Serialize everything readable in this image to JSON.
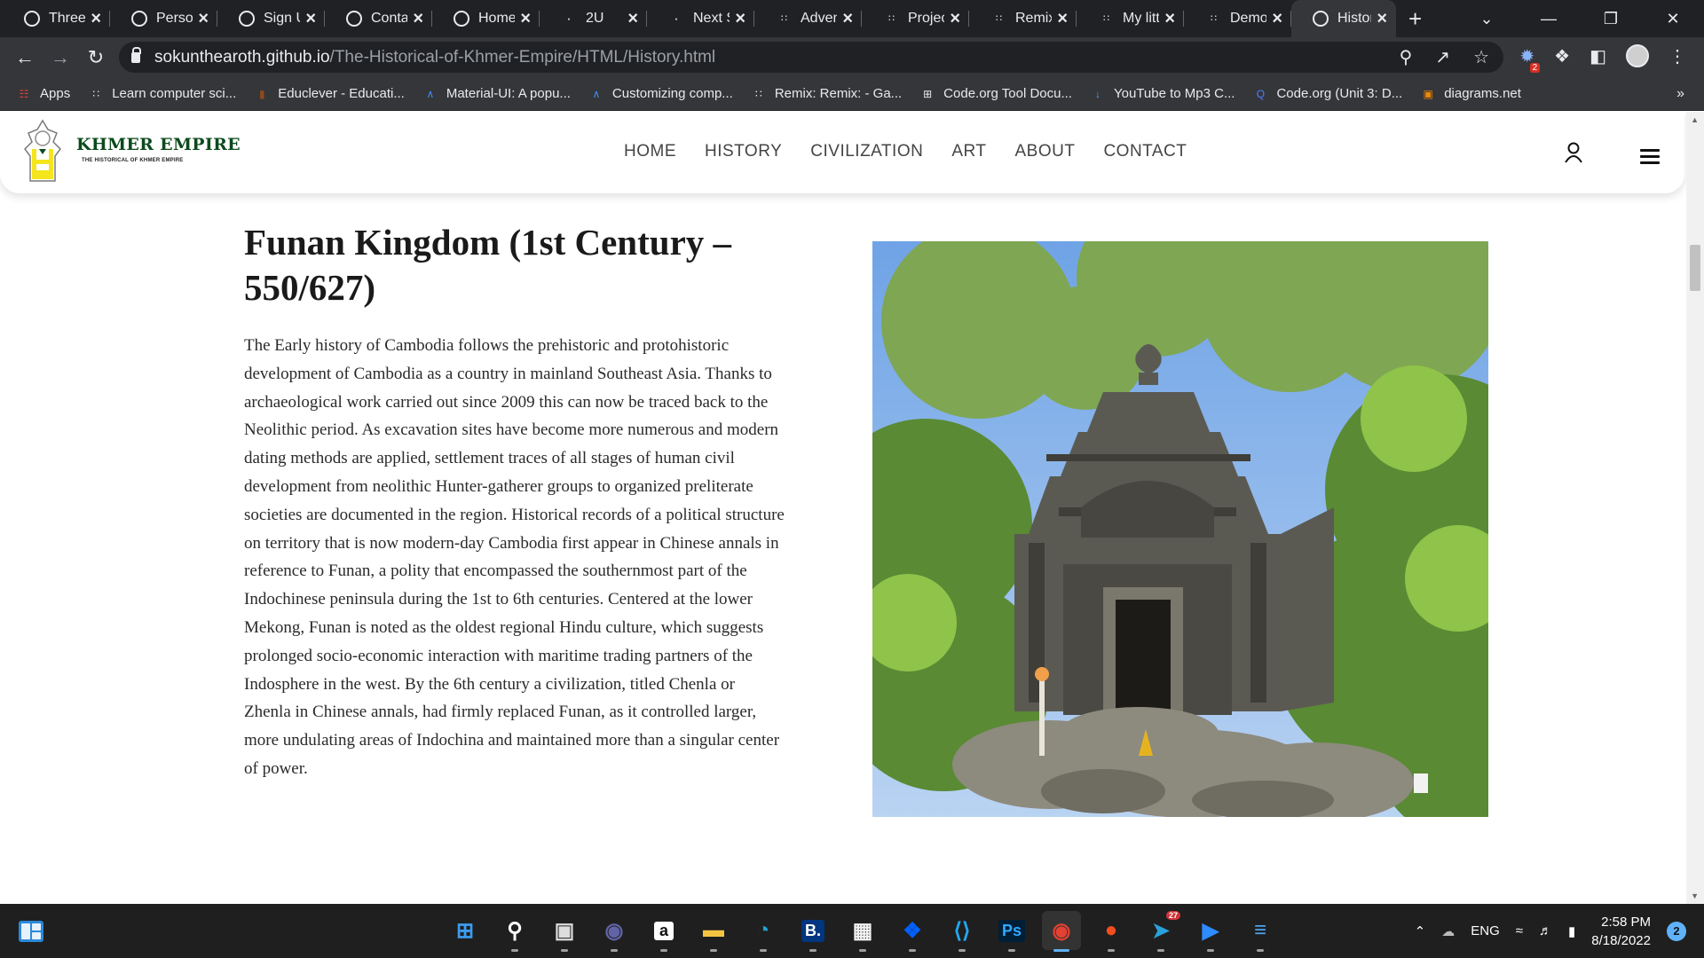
{
  "browser": {
    "tabs": [
      {
        "title": "Three",
        "icon": "globe-icon"
      },
      {
        "title": "Persor",
        "icon": "globe-icon"
      },
      {
        "title": "Sign U",
        "icon": "globe-icon"
      },
      {
        "title": "Conta",
        "icon": "globe-icon"
      },
      {
        "title": "Home",
        "icon": "globe-icon"
      },
      {
        "title": "2U",
        "icon": "page-icon"
      },
      {
        "title": "Next S",
        "icon": "next-icon"
      },
      {
        "title": "Adven",
        "icon": "codeorg-icon"
      },
      {
        "title": "Projec",
        "icon": "codeorg-icon"
      },
      {
        "title": "Remix",
        "icon": "codeorg-icon"
      },
      {
        "title": "My litt",
        "icon": "codeorg-icon"
      },
      {
        "title": "Demo",
        "icon": "codeorg-icon"
      },
      {
        "title": "Histor",
        "icon": "globe-icon",
        "active": true
      }
    ],
    "url_host": "sokunthearoth.github.io",
    "url_path": "/The-Historical-of-Khmer-Empire/HTML/History.html",
    "extension_badge": "2",
    "bookmarks": [
      {
        "label": "Apps",
        "icon": "apps-grid-icon",
        "color": "#ea4335"
      },
      {
        "label": "Learn computer sci...",
        "icon": "codeorg-icon",
        "color": "#e8eaed"
      },
      {
        "label": "Educlever - Educati...",
        "icon": "book-icon",
        "color": "#8d4b1d"
      },
      {
        "label": "Material-UI: A popu...",
        "icon": "mui-icon",
        "color": "#3f8cf7"
      },
      {
        "label": "Customizing comp...",
        "icon": "mui-icon",
        "color": "#3f8cf7"
      },
      {
        "label": "Remix: Remix: - Ga...",
        "icon": "codeorg-icon",
        "color": "#e8eaed"
      },
      {
        "label": "Code.org Tool Docu...",
        "icon": "grid-icon",
        "color": "#e8eaed"
      },
      {
        "label": "YouTube to Mp3 C...",
        "icon": "download-icon",
        "color": "#4fa3ff"
      },
      {
        "label": "Code.org (Unit 3: D...",
        "icon": "q-icon",
        "color": "#4f7cff"
      },
      {
        "label": "diagrams.net",
        "icon": "diagrams-icon",
        "color": "#f08705"
      }
    ]
  },
  "site": {
    "logo_title": "KHMER EMPIRE",
    "logo_subtitle": "THE HISTORICAL OF KHMER EMPIRE",
    "nav": [
      "HOME",
      "HISTORY",
      "CIVILIZATION",
      "ART",
      "ABOUT",
      "CONTACT"
    ]
  },
  "article": {
    "title": "Funan Kingdom (1st Century – 550/627)",
    "body": "The Early history of Cambodia follows the prehistoric and protohistoric development of Cambodia as a country in mainland Southeast Asia. Thanks to archaeological work carried out since 2009 this can now be traced back to the Neolithic period. As excavation sites have become more numerous and modern dating methods are applied, settlement traces of all stages of human civil development from neolithic Hunter-gatherer groups to organized preliterate societies are documented in the region. Historical records of a political structure on territory that is now modern-day Cambodia first appear in Chinese annals in reference to Funan, a polity that encompassed the southernmost part of the Indochinese peninsula during the 1st to 6th centuries. Centered at the lower Mekong, Funan is noted as the oldest regional Hindu culture, which suggests prolonged socio-economic interaction with maritime trading partners of the Indosphere in the west. By the 6th century a civilization, titled Chenla or Zhenla in Chinese annals, had firmly replaced Funan, as it controlled larger, more undulating areas of Indochina and maintained more than a singular center of power.",
    "image": "temple-photo"
  },
  "taskbar": {
    "apps": [
      {
        "name": "start",
        "label": ""
      },
      {
        "name": "search",
        "label": ""
      },
      {
        "name": "task-view",
        "label": ""
      },
      {
        "name": "teams",
        "label": ""
      },
      {
        "name": "amazon",
        "label": "a"
      },
      {
        "name": "file-explorer",
        "label": ""
      },
      {
        "name": "edge",
        "label": ""
      },
      {
        "name": "booking",
        "label": "B."
      },
      {
        "name": "store",
        "label": ""
      },
      {
        "name": "dropbox",
        "label": ""
      },
      {
        "name": "vscode",
        "label": ""
      },
      {
        "name": "photoshop",
        "label": "Ps"
      },
      {
        "name": "chrome",
        "label": "",
        "active": true
      },
      {
        "name": "figma",
        "label": ""
      },
      {
        "name": "telegram",
        "label": "",
        "badge": "27"
      },
      {
        "name": "zoom",
        "label": ""
      },
      {
        "name": "notepad",
        "label": ""
      }
    ],
    "language": "ENG",
    "time": "2:58 PM",
    "date": "8/18/2022",
    "notifications": "2"
  }
}
